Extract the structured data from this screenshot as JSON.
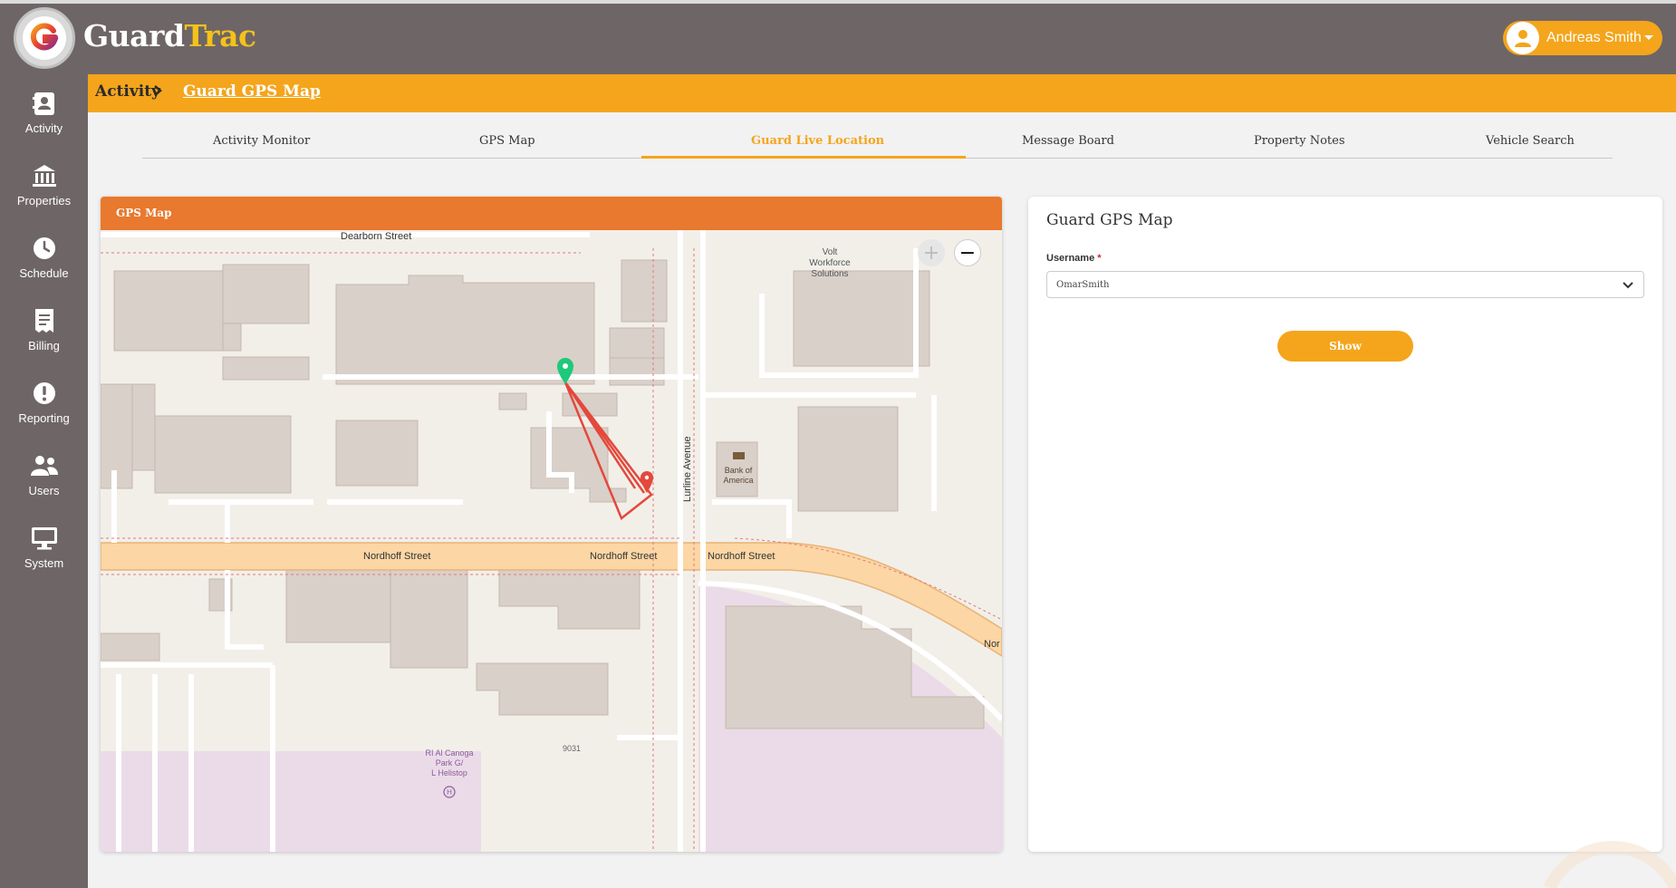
{
  "header": {
    "brand_part1": "Guard",
    "brand_part2": "Trac",
    "user_name": "Andreas Smith",
    "colors": {
      "header_bg": "#6e6666",
      "accent": "#f4a51c",
      "brand_accent": "#f5c21a"
    }
  },
  "sidebar": {
    "items": [
      {
        "label": "Activity",
        "icon": "contact-card-icon"
      },
      {
        "label": "Properties",
        "icon": "bank-building-icon"
      },
      {
        "label": "Schedule",
        "icon": "clock-icon"
      },
      {
        "label": "Billing",
        "icon": "receipt-icon"
      },
      {
        "label": "Reporting",
        "icon": "alert-icon"
      },
      {
        "label": "Users",
        "icon": "users-icon"
      },
      {
        "label": "System",
        "icon": "monitor-icon"
      }
    ]
  },
  "breadcrumb": {
    "parent": "Activity",
    "current": "Guard GPS Map"
  },
  "tabs": [
    {
      "label": "Activity Monitor",
      "active": false
    },
    {
      "label": "GPS Map",
      "active": false
    },
    {
      "label": "Guard Live Location",
      "active": true
    },
    {
      "label": "Message Board",
      "active": false
    },
    {
      "label": "Property Notes",
      "active": false
    },
    {
      "label": "Vehicle Search",
      "active": false
    }
  ],
  "map_card": {
    "title": "GPS Map",
    "zoom_in": "+",
    "zoom_out": "−",
    "labels": {
      "dearborn": "Dearborn Street",
      "nordhoff1": "Nordhoff Street",
      "nordhoff2": "Nordhoff Street",
      "nordhoff3": "Nordhoff Street",
      "nordhoff_cut": "Nor",
      "lurline": "Lurline Avenue",
      "volt1": "Volt",
      "volt2": "Workforce",
      "volt3": "Solutions",
      "bank1": "Bank of",
      "bank2": "America",
      "park1": "RI Al Canoga",
      "park2": "Park G/",
      "park3": "L Helistop",
      "heli": "H",
      "num": "9031"
    }
  },
  "form": {
    "title": "Guard GPS Map",
    "username_label": "Username",
    "required_mark": "*",
    "username_value": "OmarSmith",
    "show_label": "Show"
  }
}
